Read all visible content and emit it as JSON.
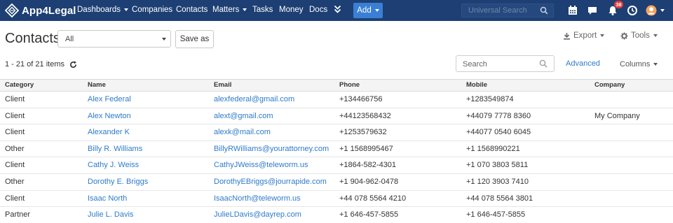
{
  "navbar": {
    "brand": "App4Legal",
    "items": [
      {
        "label": "Dashboards",
        "has_caret": true
      },
      {
        "label": "Companies",
        "has_caret": false
      },
      {
        "label": "Contacts",
        "has_caret": false
      },
      {
        "label": "Matters",
        "has_caret": true
      },
      {
        "label": "Tasks",
        "has_caret": false
      },
      {
        "label": "Money",
        "has_caret": false
      },
      {
        "label": "Docs",
        "has_caret": false
      }
    ],
    "more_icon": "double-chevron-down-icon",
    "add_label": "Add",
    "search_placeholder": "Universal Search",
    "notification_count": "38",
    "right_icons": [
      "calendar-icon",
      "chat-icon",
      "bell-icon",
      "clock-icon",
      "user-avatar-icon"
    ],
    "colors": {
      "bar": "#1d3f73",
      "add_button": "#3a7fd5",
      "badge": "#e03a3a"
    }
  },
  "toolbar": {
    "title": "Contacts",
    "view_select_value": "All",
    "save_as_label": "Save as",
    "export_label": "Export",
    "tools_label": "Tools"
  },
  "list_controls": {
    "items_count": "1 - 21 of 21 items",
    "search_placeholder": "Search",
    "advanced_label": "Advanced",
    "columns_label": "Columns"
  },
  "table": {
    "columns": [
      "Category",
      "Name",
      "Email",
      "Phone",
      "Mobile",
      "Company"
    ],
    "rows": [
      {
        "category": "Client",
        "name": "Alex Federal",
        "email": "alexfederal@gmail.com",
        "phone": "+134466756",
        "mobile": "+1283549874",
        "company": ""
      },
      {
        "category": "Client",
        "name": "Alex Newton",
        "email": "alext@gmail.com",
        "phone": "+44123568432",
        "mobile": "+44079 7778 8360",
        "company": "My Company"
      },
      {
        "category": "Client",
        "name": "Alexander K",
        "email": "alexk@mail.com",
        "phone": "+1253579632",
        "mobile": "+44077 0540 6045",
        "company": ""
      },
      {
        "category": "Other",
        "name": "Billy R. Williams",
        "email": "BillyRWilliams@yourattorney.com",
        "phone": "+1 1568995467",
        "mobile": "+1 1568990221",
        "company": ""
      },
      {
        "category": "Client",
        "name": "Cathy J. Weiss",
        "email": "CathyJWeiss@teleworm.us",
        "phone": "+1864-582-4301",
        "mobile": "+1 070 3803 5811",
        "company": ""
      },
      {
        "category": "Other",
        "name": "Dorothy E. Briggs",
        "email": "DorothyEBriggs@jourrapide.com",
        "phone": "+1 904-962-0478",
        "mobile": "+1 120 3903 7410",
        "company": ""
      },
      {
        "category": "Client",
        "name": "Isaac North",
        "email": "IsaacNorth@teleworm.us",
        "phone": "+44 078 5564 4210",
        "mobile": "+44 078 5564 3801",
        "company": ""
      },
      {
        "category": "Partner",
        "name": "Julie L. Davis",
        "email": "JulieLDavis@dayrep.com",
        "phone": "+1 646-457-5855",
        "mobile": "+1 646-457-5855",
        "company": ""
      }
    ]
  }
}
